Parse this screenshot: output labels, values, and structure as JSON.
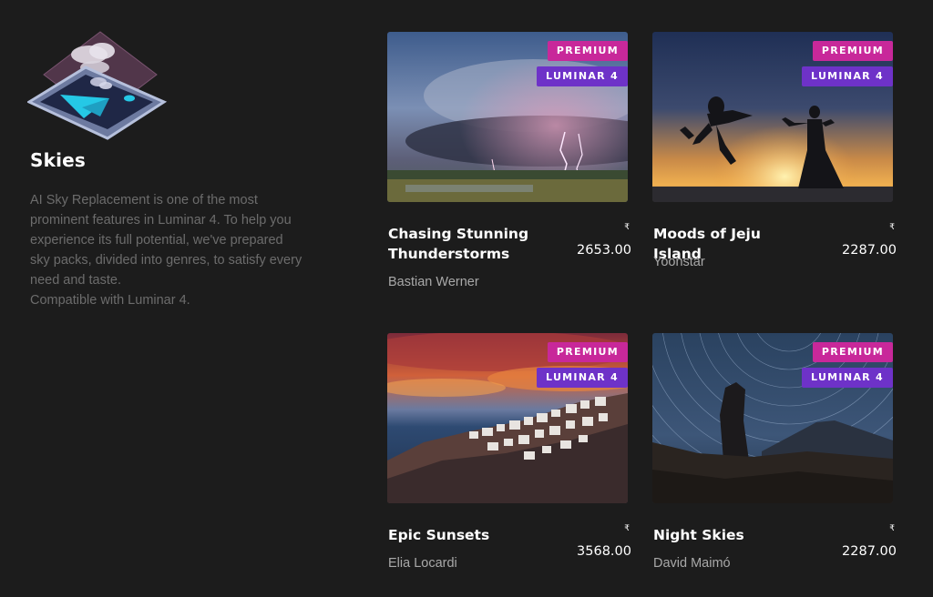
{
  "category": {
    "icon": "sky-layers-icon",
    "title": "Skies",
    "description": [
      "AI Sky Replacement is one of the most prominent features in Luminar 4. To help you experience its full potential, we've prepared sky packs, divided into genres, to satisfy every need and taste.",
      "Compatible with Luminar 4."
    ]
  },
  "products": [
    {
      "title": "Chasing Stunning Thunderstorms",
      "author": "Bastian Werner",
      "currency": "₹",
      "price": "2653.00",
      "badges": [
        "PREMIUM",
        "LUMINAR 4"
      ],
      "image": "thunderstorm-image"
    },
    {
      "title": "Moods of Jeju Island",
      "author": "Yoonstar",
      "currency": "₹",
      "price": "2287.00",
      "badges": [
        "PREMIUM",
        "LUMINAR 4"
      ],
      "image": "jeju-sunset-silhouettes-image"
    },
    {
      "title": "Epic Sunsets",
      "author": "Elia Locardi",
      "currency": "₹",
      "price": "3568.00",
      "badges": [
        "PREMIUM",
        "LUMINAR 4"
      ],
      "image": "santorini-sunset-image"
    },
    {
      "title": "Night Skies",
      "author": "David Maimó",
      "currency": "₹",
      "price": "2287.00",
      "badges": [
        "PREMIUM",
        "LUMINAR 4"
      ],
      "image": "star-trails-image"
    }
  ],
  "colors": {
    "background": "#1c1c1c",
    "premium_badge": "#c8289a",
    "luminar_badge": "#6e32c8",
    "title_text": "#ffffff",
    "description_text": "#6c6c6c",
    "author_text": "#a9a9a9"
  }
}
